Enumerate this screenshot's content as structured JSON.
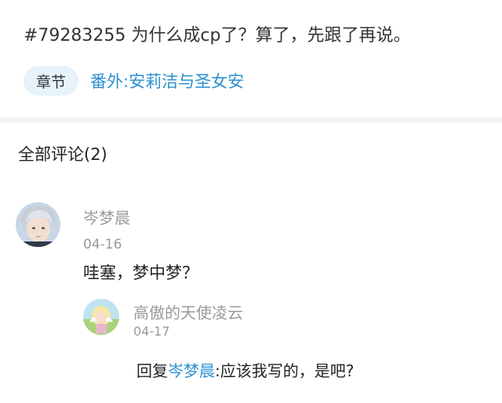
{
  "post": {
    "title": "#79283255 为什么成cp了？算了，先跟了再说。",
    "chapter_tag": "章节",
    "chapter_link": "番外:安莉洁与圣女安"
  },
  "comments_header": "全部评论(2)",
  "comments": [
    {
      "user": "岑梦晨",
      "date": "04-16",
      "text": "哇塞，梦中梦？",
      "replies": [
        {
          "user": "高傲的天使凌云",
          "date": "04-17",
          "reply_prefix": "回复",
          "mention": "岑梦晨",
          "text": ":应该我写的，是吧?"
        }
      ]
    }
  ],
  "colors": {
    "accent": "#2b8fd0",
    "tag_bg": "#e6f3fb",
    "muted": "#9a9a9a",
    "divider": "#f2f2f2"
  }
}
